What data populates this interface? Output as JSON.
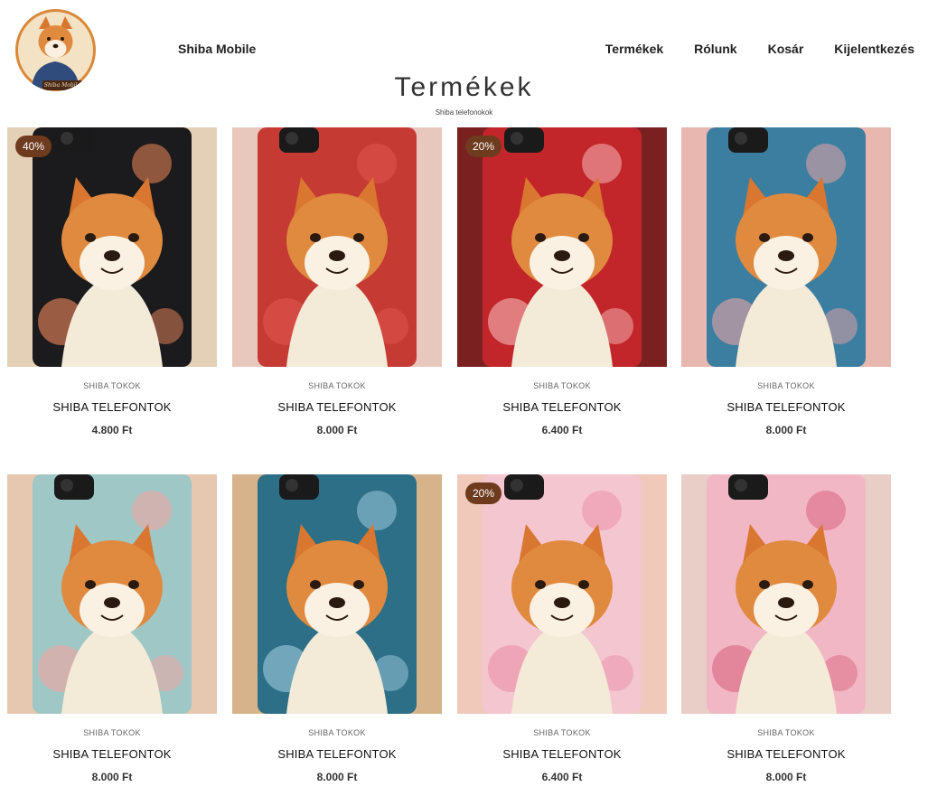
{
  "header": {
    "brand": "Shiba Mobile",
    "logo_text": "Shiba Mobile",
    "nav": [
      "Termékek",
      "Rólunk",
      "Kosár",
      "Kijelentkezés"
    ]
  },
  "page": {
    "title": "Termékek",
    "subtitle": "Shiba telefonokok"
  },
  "products": [
    {
      "category": "SHIBA TOKOK",
      "name": "SHIBA TELEFONTOK",
      "price": "4.800 Ft",
      "badge": "40%",
      "bg": "#1b1a1c",
      "accent": "#f08a5d",
      "side": "#e4cfb7"
    },
    {
      "category": "SHIBA TOKOK",
      "name": "SHIBA TELEFONTOK",
      "price": "8.000 Ft",
      "badge": "",
      "bg": "#c63a34",
      "accent": "#e0574f",
      "side": "#e8c8bd"
    },
    {
      "category": "SHIBA TOKOK",
      "name": "SHIBA TELEFONTOK",
      "price": "6.400 Ft",
      "badge": "20%",
      "bg": "#c3262a",
      "accent": "#f5b7b9",
      "side": "#7a2020"
    },
    {
      "category": "SHIBA TOKOK",
      "name": "SHIBA TELEFONTOK",
      "price": "8.000 Ft",
      "badge": "",
      "bg": "#3b7ea0",
      "accent": "#e9a4a6",
      "side": "#e7b7b0"
    },
    {
      "category": "SHIBA TOKOK",
      "name": "SHIBA TELEFONTOK",
      "price": "8.000 Ft",
      "badge": "",
      "bg": "#9fc7c6",
      "accent": "#f5a3a0",
      "side": "#e6c7b0"
    },
    {
      "category": "SHIBA TOKOK",
      "name": "SHIBA TELEFONTOK",
      "price": "8.000 Ft",
      "badge": "",
      "bg": "#2d6f86",
      "accent": "#9fcbe0",
      "side": "#d7b38b"
    },
    {
      "category": "SHIBA TOKOK",
      "name": "SHIBA TELEFONTOK",
      "price": "6.400 Ft",
      "badge": "20%",
      "bg": "#f3c6d0",
      "accent": "#ec8fa9",
      "side": "#f0c9bb"
    },
    {
      "category": "SHIBA TOKOK",
      "name": "SHIBA TELEFONTOK",
      "price": "8.000 Ft",
      "badge": "",
      "bg": "#f2b7c5",
      "accent": "#d9657f",
      "side": "#e9cdc7"
    }
  ]
}
